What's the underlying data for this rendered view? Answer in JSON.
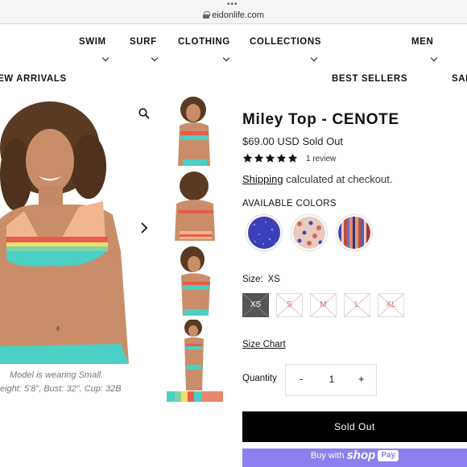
{
  "browser": {
    "url": "eidonlife.com",
    "more_icon": "more-dots-icon",
    "lock_icon": "lock-icon"
  },
  "nav": {
    "top": [
      {
        "label": "SWIM",
        "has_dropdown": true
      },
      {
        "label": "SURF",
        "has_dropdown": true
      },
      {
        "label": "CLOTHING",
        "has_dropdown": true
      },
      {
        "label": "COLLECTIONS",
        "has_dropdown": true
      },
      {
        "label": "MEN",
        "has_dropdown": true
      }
    ],
    "bottom": [
      {
        "label": "EW ARRIVALS"
      },
      {
        "label": "BEST SELLERS"
      },
      {
        "label": "SAL"
      }
    ]
  },
  "gallery": {
    "caption_line1": "Model is wearing Small.",
    "caption_line2": "eight: 5'8\", Bust: 32\", Cup: 32B",
    "zoom_icon": "magnifier-icon",
    "next_icon": "chevron-right-icon",
    "thumb_count": 5
  },
  "product": {
    "title": "Miley Top - CENOTE",
    "price": "$69.00 USD",
    "availability": "Sold Out",
    "rating": 5,
    "reviews": "1 review",
    "shipping_link": "Shipping",
    "shipping_text": " calculated at checkout.",
    "colors_label": "AVAILABLE COLORS",
    "colors": [
      {
        "name": "blue-glitter",
        "base": "#3b3fb8"
      },
      {
        "name": "floral",
        "base": "#e9c9c2"
      },
      {
        "name": "stripe",
        "base": "#c56a5a"
      }
    ],
    "size_label": "Size:",
    "size_selected": "XS",
    "sizes": [
      {
        "label": "XS",
        "selected": true
      },
      {
        "label": "S",
        "selected": false
      },
      {
        "label": "M",
        "selected": false
      },
      {
        "label": "L",
        "selected": false
      },
      {
        "label": "XL",
        "selected": false
      }
    ],
    "size_chart": "Size Chart",
    "quantity_label": "Quantity",
    "quantity_minus": "-",
    "quantity_value": "1",
    "quantity_plus": "+",
    "sold_out_button": "Sold Out",
    "shop_pay": {
      "buy": "Buy with",
      "shop": "shop",
      "pay": "Pay"
    }
  },
  "colors": {
    "accent_black": "#000000",
    "shop_pay_purple": "#8e7ff0",
    "sold_out_size": "#c77777"
  }
}
